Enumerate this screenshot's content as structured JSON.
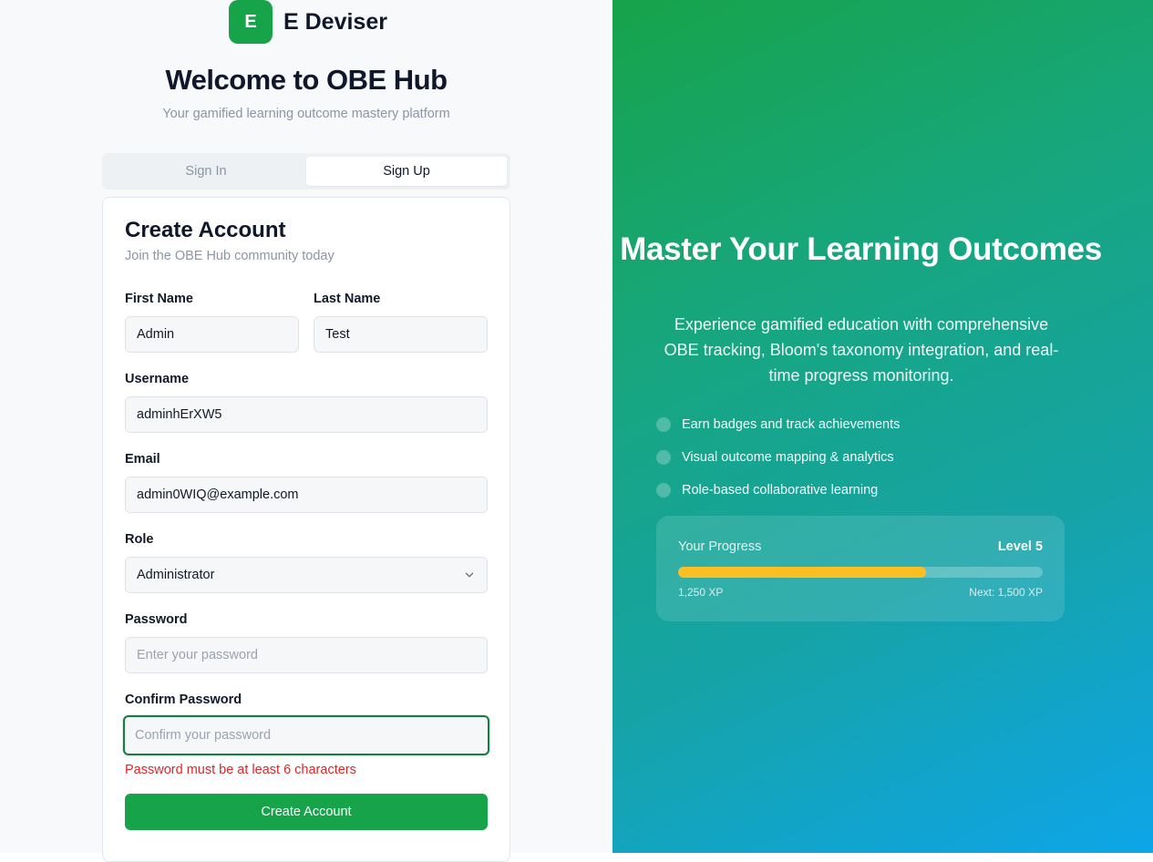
{
  "brand": {
    "logo_letter": "E",
    "name": "E Deviser",
    "color": "#16a34a"
  },
  "welcome": {
    "title": "Welcome to OBE Hub",
    "subtitle": "Your gamified learning outcome mastery platform"
  },
  "tabs": [
    {
      "label": "Sign In",
      "active": false
    },
    {
      "label": "Sign Up",
      "active": true
    }
  ],
  "form": {
    "title": "Create Account",
    "subtitle": "Join the OBE Hub community today",
    "first_name": {
      "label": "First Name",
      "value": "Admin"
    },
    "last_name": {
      "label": "Last Name",
      "value": "Test"
    },
    "username": {
      "label": "Username",
      "value": "adminhErXW5"
    },
    "email": {
      "label": "Email",
      "value": "admin0WIQ@example.com"
    },
    "role": {
      "label": "Role",
      "value": "Administrator"
    },
    "password": {
      "label": "Password",
      "value": "",
      "placeholder": "Enter your password"
    },
    "confirm_password": {
      "label": "Confirm Password",
      "value": "",
      "placeholder": "Confirm your password"
    },
    "error": "Password must be at least 6 characters",
    "submit_label": "Create Account"
  },
  "hero": {
    "title": "Master Your Learning Outcomes",
    "description": "Experience gamified education with comprehensive OBE tracking, Bloom's taxonomy integration, and real-time progress monitoring.",
    "features": [
      "Earn badges and track achievements",
      "Visual outcome mapping & analytics",
      "Role-based collaborative learning"
    ],
    "progress": {
      "label": "Your Progress",
      "level": "Level 5",
      "xp": "1,250 XP",
      "next": "Next: 1,500 XP",
      "fraction": 0.68,
      "bar_color": "#fbbf24"
    }
  }
}
